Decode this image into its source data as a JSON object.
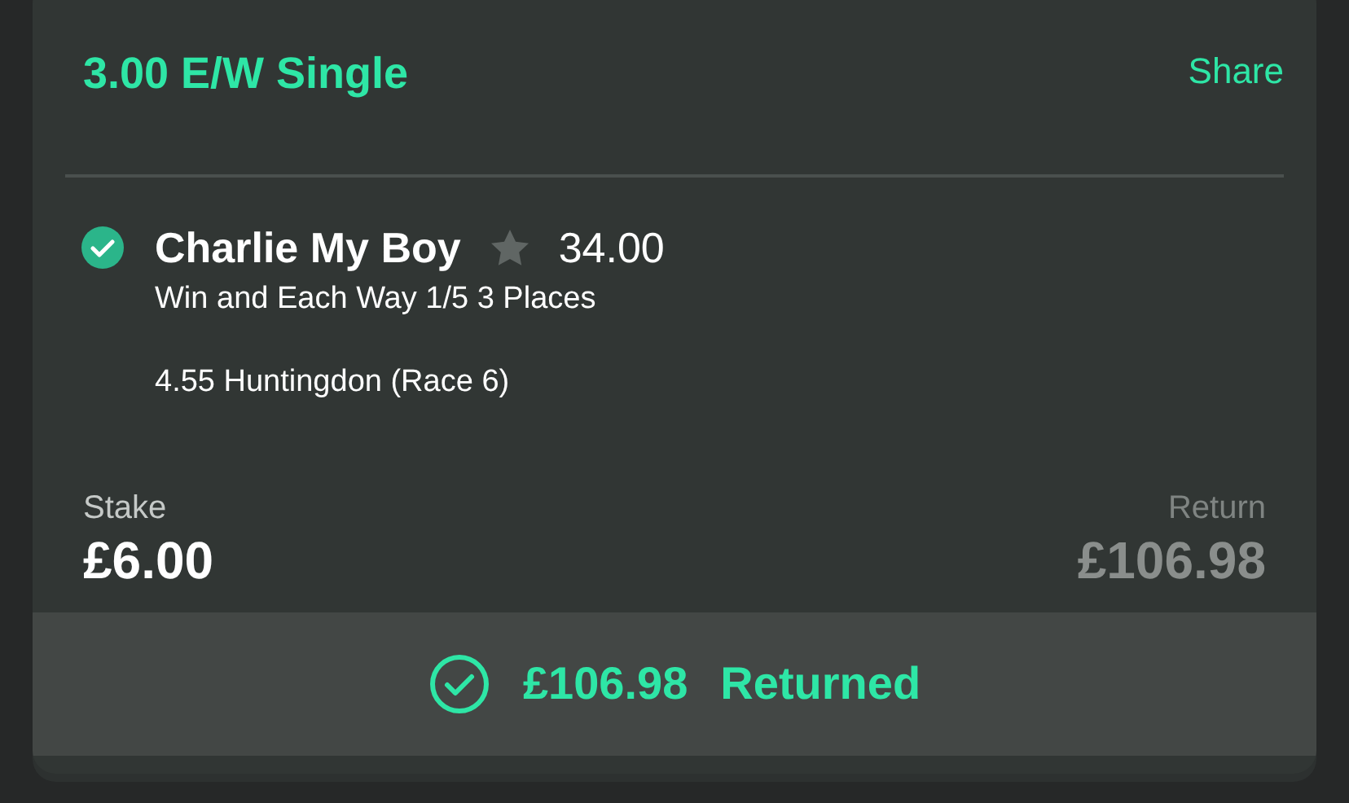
{
  "bet": {
    "title": "3.00 E/W Single",
    "share": "Share"
  },
  "selection": {
    "name": "Charlie My Boy",
    "won": true,
    "odds": "34.00",
    "market": "Win and Each Way 1/5 3 Places",
    "event": "4.55 Huntingdon (Race 6)"
  },
  "stake": {
    "label": "Stake",
    "value": "£6.00"
  },
  "return": {
    "label": "Return",
    "value": "£106.98"
  },
  "footer": {
    "amount": "£106.98",
    "status": "Returned",
    "settled": true
  }
}
